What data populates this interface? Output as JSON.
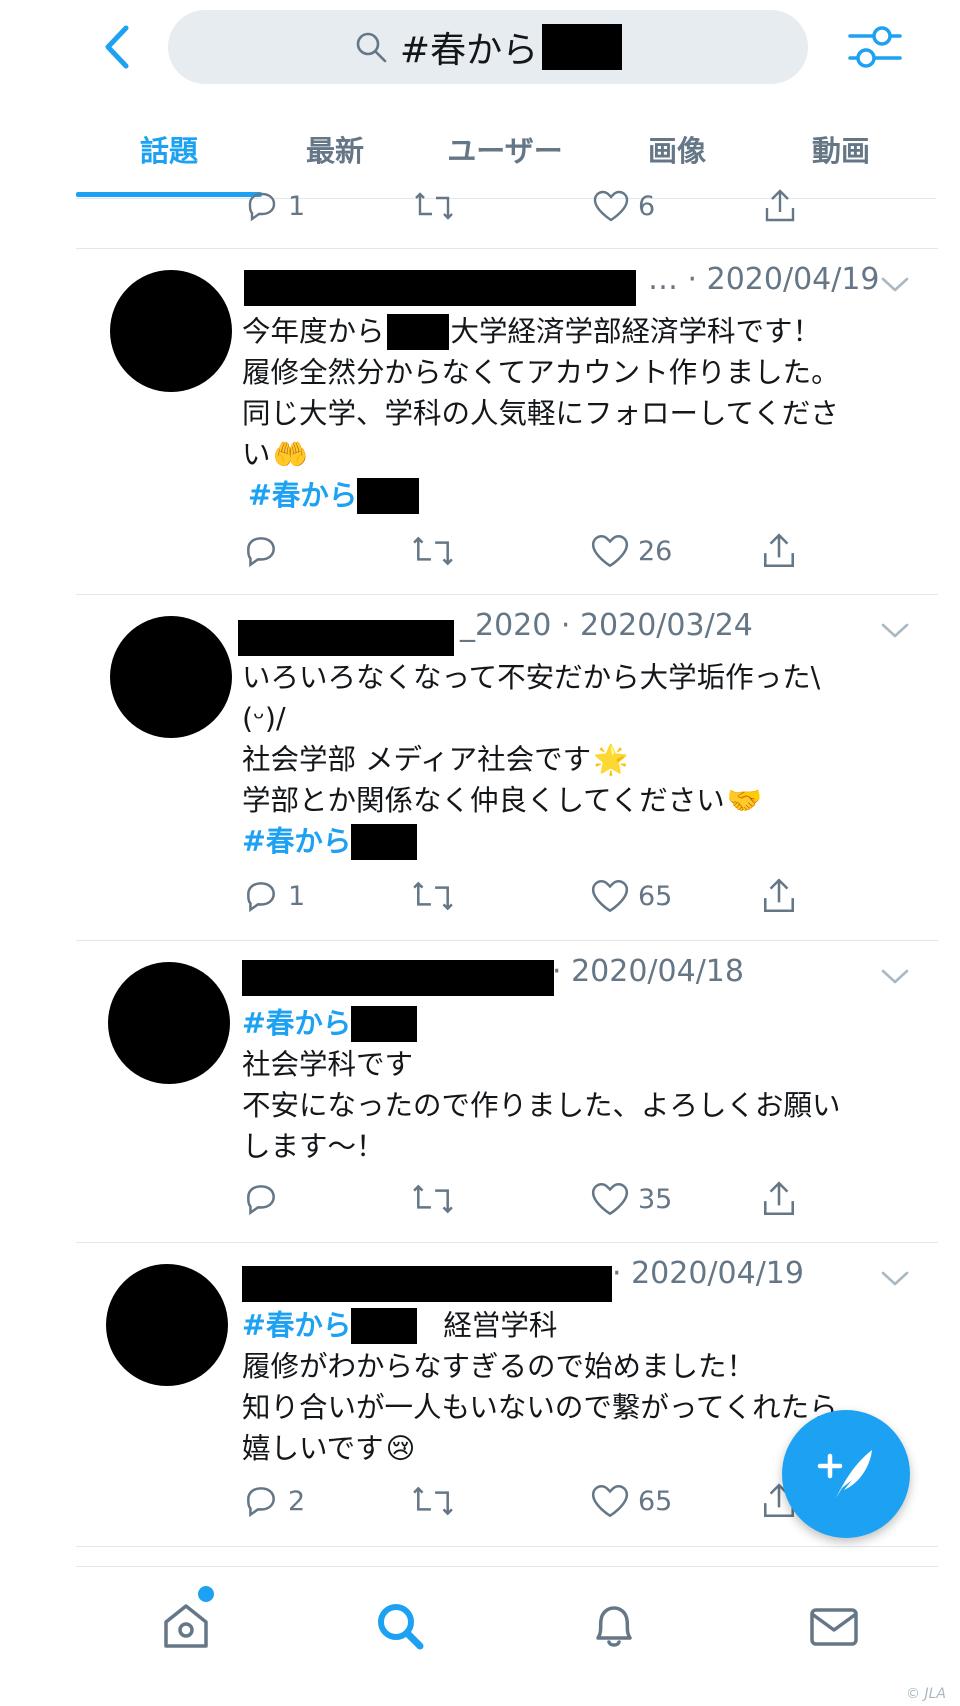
{
  "search": {
    "query": "#春から"
  },
  "tabs": [
    {
      "label": "話題",
      "active": true
    },
    {
      "label": "最新"
    },
    {
      "label": "ユーザー"
    },
    {
      "label": "画像"
    },
    {
      "label": "動画"
    }
  ],
  "partial_tweet": {
    "replies": "1",
    "likes": "6"
  },
  "tweets": [
    {
      "meta": "… · 2020/04/19",
      "lines": [
        {
          "pre": "今年度から",
          "redact": true,
          "post": "大学経済学部経済学科です！"
        },
        {
          "text": "履修全然分からなくてアカウント作りました。"
        },
        {
          "text": "同じ大学、学科の人気軽にフォローしてくださ"
        },
        {
          "text": "い",
          "emoji": "🤲"
        },
        {
          "tag": "#春から"
        }
      ],
      "replies": "",
      "likes": "26"
    },
    {
      "meta": "_2020 · 2020/03/24",
      "lines": [
        {
          "text": "いろいろなくなって不安だから大学垢作った\\"
        },
        {
          "text": "(ᵕ)/"
        },
        {
          "text": "社会学部 メディア社会です",
          "emoji": "🌟"
        },
        {
          "text": "学部とか関係なく仲良くしてください",
          "emoji": "🤝"
        },
        {
          "tag": "#春から"
        }
      ],
      "replies": "1",
      "likes": "65"
    },
    {
      "meta": "· 2020/04/18",
      "lines": [
        {
          "tag": "#春から"
        },
        {
          "text": "社会学科です"
        },
        {
          "text": "不安になったので作りました、よろしくお願い"
        },
        {
          "text": "します〜！"
        }
      ],
      "replies": "",
      "likes": "35"
    },
    {
      "meta": "· 2020/04/19",
      "lines": [
        {
          "tag": "#春から",
          "post": "経営学科"
        },
        {
          "text": "履修がわからなすぎるので始めました！"
        },
        {
          "text": "知り合いが一人もいないので繋がってくれたら"
        },
        {
          "text": "嬉しいです",
          "emoji": "😢"
        }
      ],
      "replies": "2",
      "likes": "65"
    }
  ],
  "watermark": "© JLA",
  "colors": {
    "accent": "#1da1f2",
    "muted": "#657786",
    "search_bg": "#e6ecf0"
  }
}
